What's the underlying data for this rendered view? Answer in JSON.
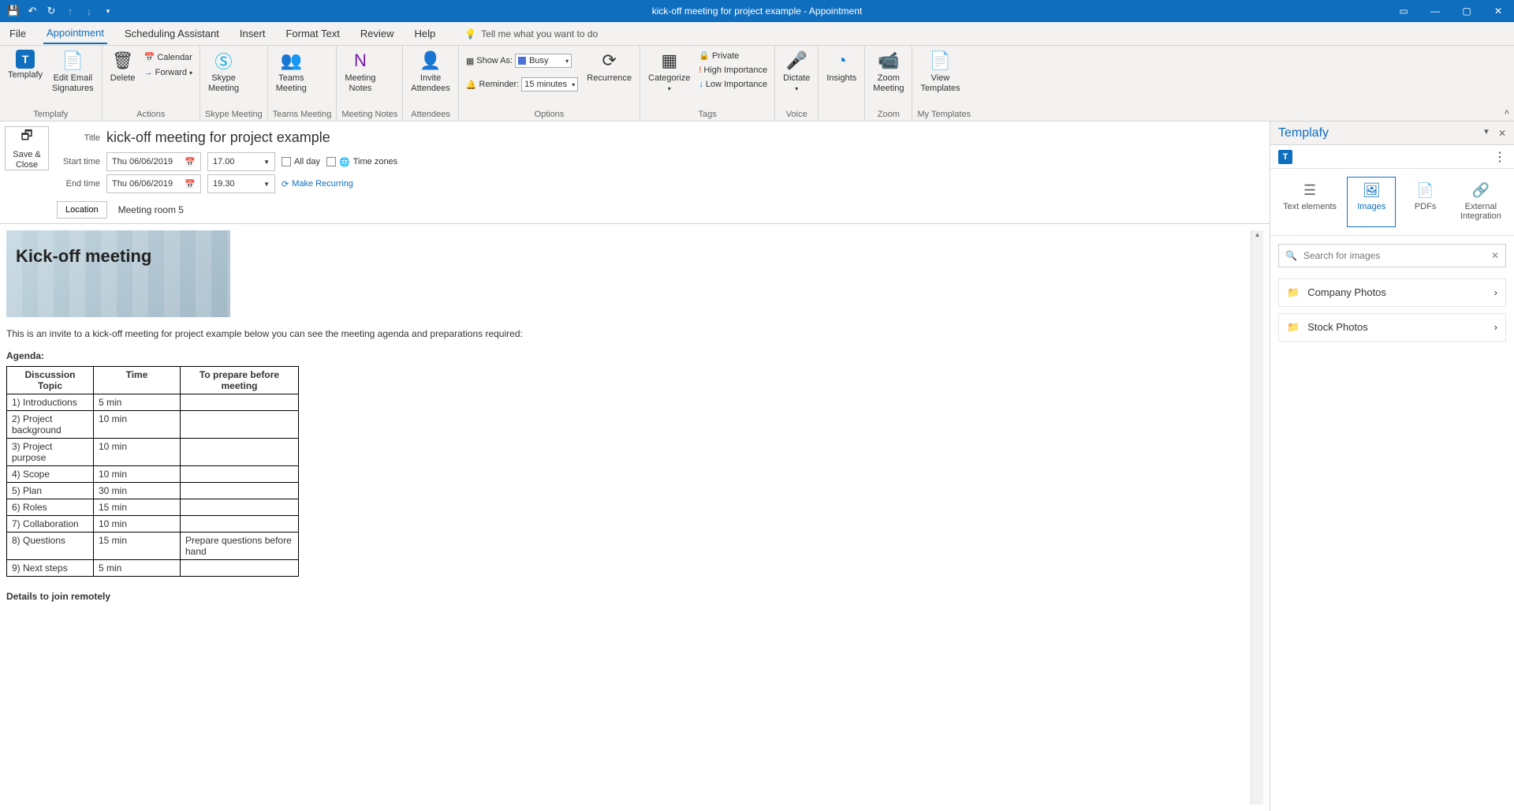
{
  "titlebar": {
    "title": "kick-off meeting for project example  - Appointment"
  },
  "tabs": {
    "file": "File",
    "appointment": "Appointment",
    "scheduling": "Scheduling Assistant",
    "insert": "Insert",
    "format": "Format Text",
    "review": "Review",
    "help": "Help",
    "tellme": "Tell me what you want to do"
  },
  "ribbon": {
    "templafy": {
      "templafy": "Templafy",
      "edit_email": "Edit Email\nSignatures",
      "group": "Templafy"
    },
    "actions": {
      "delete": "Delete",
      "calendar": "Calendar",
      "forward": "Forward",
      "group": "Actions"
    },
    "skype": {
      "btn": "Skype\nMeeting",
      "group": "Skype Meeting"
    },
    "teams": {
      "btn": "Teams\nMeeting",
      "group": "Teams Meeting"
    },
    "notes": {
      "btn": "Meeting\nNotes",
      "group": "Meeting Notes"
    },
    "attendees": {
      "btn": "Invite\nAttendees",
      "group": "Attendees"
    },
    "options": {
      "showas_label": "Show As:",
      "showas_value": "Busy",
      "reminder_label": "Reminder:",
      "reminder_value": "15 minutes",
      "recurrence": "Recurrence",
      "group": "Options"
    },
    "tags": {
      "categorize": "Categorize",
      "private": "Private",
      "high": "High Importance",
      "low": "Low Importance",
      "group": "Tags"
    },
    "voice": {
      "dictate": "Dictate",
      "group": "Voice"
    },
    "insights": {
      "btn": "Insights"
    },
    "zoom": {
      "btn": "Zoom\nMeeting",
      "group": "Zoom"
    },
    "mytemplates": {
      "btn": "View\nTemplates",
      "group": "My Templates"
    }
  },
  "form": {
    "save_close": "Save &\nClose",
    "title_label": "Title",
    "title_value": "kick-off meeting for project example",
    "start_label": "Start time",
    "end_label": "End time",
    "start_date": "Thu 06/06/2019",
    "end_date": "Thu 06/06/2019",
    "start_time": "17.00",
    "end_time": "19.30",
    "allday": "All day",
    "timezones": "Time zones",
    "recurring": "Make Recurring",
    "location_label": "Location",
    "location_value": "Meeting room 5"
  },
  "body": {
    "banner": "Kick-off meeting",
    "intro": "This is an invite to a kick-off meeting for project example below you can see the meeting agenda and preparations required:",
    "agenda_label": "Agenda:",
    "headers": {
      "topic": "Discussion Topic",
      "time": "Time",
      "prep": "To prepare before meeting"
    },
    "rows": [
      {
        "topic": "1) Introductions",
        "time": "5 min",
        "prep": ""
      },
      {
        "topic": "2) Project background",
        "time": "10 min",
        "prep": ""
      },
      {
        "topic": "3) Project purpose",
        "time": "10 min",
        "prep": ""
      },
      {
        "topic": "4) Scope",
        "time": "10 min",
        "prep": ""
      },
      {
        "topic": "5) Plan",
        "time": "30 min",
        "prep": ""
      },
      {
        "topic": "6) Roles",
        "time": "15 min",
        "prep": ""
      },
      {
        "topic": "7) Collaboration",
        "time": "10 min",
        "prep": ""
      },
      {
        "topic": "8) Questions",
        "time": "15 min",
        "prep": "Prepare questions before hand"
      },
      {
        "topic": "9) Next steps",
        "time": "5 min",
        "prep": ""
      }
    ],
    "remote": "Details to join remotely"
  },
  "sidepanel": {
    "title": "Templafy",
    "tabs": {
      "text": "Text elements",
      "images": "Images",
      "pdfs": "PDFs",
      "external": "External\nIntegration"
    },
    "search_placeholder": "Search for images",
    "folders": {
      "company": "Company Photos",
      "stock": "Stock Photos"
    }
  }
}
